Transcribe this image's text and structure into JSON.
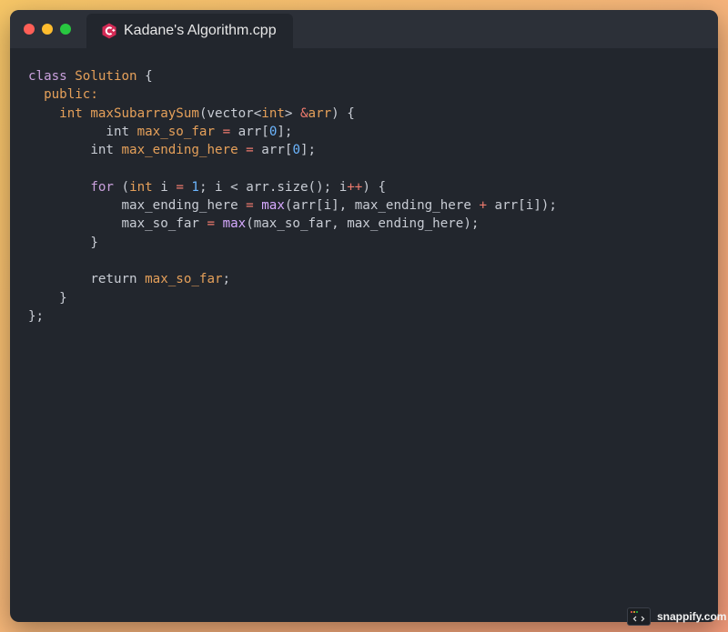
{
  "window": {
    "tab_title": "Kadane's Algorithm.cpp",
    "tab_icon": "cpp-file-icon"
  },
  "colors": {
    "keyword": "#c9a0dc",
    "type_and_identifier": "#e5a05a",
    "number": "#6cb6ff",
    "operator": "#ef7b6e",
    "plain": "#c8ccd4",
    "function_call": "#d6a9ff",
    "editor_background": "#22262d",
    "titlebar_background": "#2c3038"
  },
  "code": {
    "lines": [
      [
        {
          "t": "class ",
          "c": "kw"
        },
        {
          "t": "Solution",
          "c": "orange"
        },
        {
          "t": " {",
          "c": "plain"
        }
      ],
      [
        {
          "t": "  ",
          "c": "plain"
        },
        {
          "t": "public:",
          "c": "orange"
        }
      ],
      [
        {
          "t": "    ",
          "c": "plain"
        },
        {
          "t": "int",
          "c": "orange"
        },
        {
          "t": " ",
          "c": "plain"
        },
        {
          "t": "maxSubarraySum",
          "c": "orange"
        },
        {
          "t": "(vector<",
          "c": "plain"
        },
        {
          "t": "int",
          "c": "orange"
        },
        {
          "t": "> ",
          "c": "plain"
        },
        {
          "t": "&",
          "c": "op"
        },
        {
          "t": "arr",
          "c": "orange"
        },
        {
          "t": ") {",
          "c": "plain"
        }
      ],
      [
        {
          "t": "          int ",
          "c": "plain"
        },
        {
          "t": "max_so_far",
          "c": "orange"
        },
        {
          "t": " ",
          "c": "plain"
        },
        {
          "t": "=",
          "c": "op"
        },
        {
          "t": " arr[",
          "c": "plain"
        },
        {
          "t": "0",
          "c": "num"
        },
        {
          "t": "];",
          "c": "plain"
        }
      ],
      [
        {
          "t": "        int ",
          "c": "plain"
        },
        {
          "t": "max_ending_here",
          "c": "orange"
        },
        {
          "t": " ",
          "c": "plain"
        },
        {
          "t": "=",
          "c": "op"
        },
        {
          "t": " arr[",
          "c": "plain"
        },
        {
          "t": "0",
          "c": "num"
        },
        {
          "t": "];",
          "c": "plain"
        }
      ],
      [],
      [
        {
          "t": "        ",
          "c": "plain"
        },
        {
          "t": "for",
          "c": "kw"
        },
        {
          "t": " (",
          "c": "plain"
        },
        {
          "t": "int",
          "c": "orange"
        },
        {
          "t": " i ",
          "c": "plain"
        },
        {
          "t": "=",
          "c": "op"
        },
        {
          "t": " ",
          "c": "plain"
        },
        {
          "t": "1",
          "c": "num"
        },
        {
          "t": "; i ",
          "c": "plain"
        },
        {
          "t": "<",
          "c": "plain"
        },
        {
          "t": " arr.size(); i",
          "c": "plain"
        },
        {
          "t": "++",
          "c": "op"
        },
        {
          "t": ") {",
          "c": "plain"
        }
      ],
      [
        {
          "t": "            max_ending_here ",
          "c": "plain"
        },
        {
          "t": "=",
          "c": "op"
        },
        {
          "t": " ",
          "c": "plain"
        },
        {
          "t": "max",
          "c": "fn"
        },
        {
          "t": "(arr[i], max_ending_here ",
          "c": "plain"
        },
        {
          "t": "+",
          "c": "op"
        },
        {
          "t": " arr[i]);",
          "c": "plain"
        }
      ],
      [
        {
          "t": "            max_so_far ",
          "c": "plain"
        },
        {
          "t": "=",
          "c": "op"
        },
        {
          "t": " ",
          "c": "plain"
        },
        {
          "t": "max",
          "c": "fn"
        },
        {
          "t": "(max_so_far, max_ending_here);",
          "c": "plain"
        }
      ],
      [
        {
          "t": "        }",
          "c": "plain"
        }
      ],
      [],
      [
        {
          "t": "        return ",
          "c": "plain"
        },
        {
          "t": "max_so_far",
          "c": "orange"
        },
        {
          "t": ";",
          "c": "plain"
        }
      ],
      [
        {
          "t": "    }",
          "c": "plain"
        }
      ],
      [
        {
          "t": "};",
          "c": "plain"
        }
      ]
    ]
  },
  "watermark": {
    "label": "snappify.com",
    "icon": "code-brackets-icon"
  }
}
